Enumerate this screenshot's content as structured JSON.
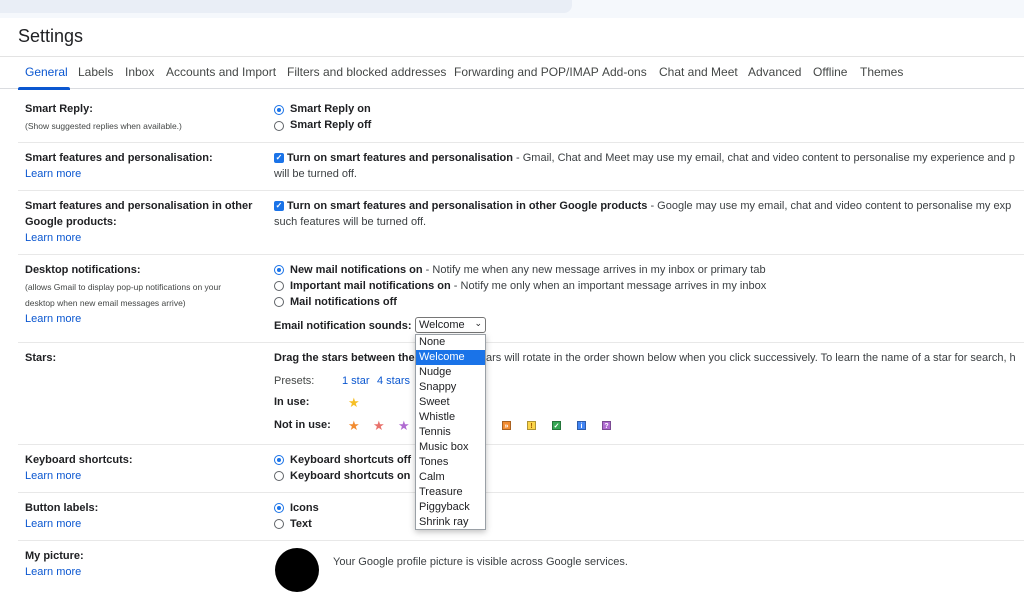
{
  "header": {
    "title": "Settings"
  },
  "tabs": [
    {
      "label": "General"
    },
    {
      "label": "Labels"
    },
    {
      "label": "Inbox"
    },
    {
      "label": "Accounts and Import"
    },
    {
      "label": "Filters and blocked addresses"
    },
    {
      "label": "Forwarding and POP/IMAP"
    },
    {
      "label": "Add-ons"
    },
    {
      "label": "Chat and Meet"
    },
    {
      "label": "Advanced"
    },
    {
      "label": "Offline"
    },
    {
      "label": "Themes"
    }
  ],
  "smart_reply": {
    "label": "Smart Reply:",
    "sub": "(Show suggested replies when available.)",
    "options": [
      "Smart Reply on",
      "Smart Reply off"
    ],
    "selected": "Smart Reply on"
  },
  "smart_features": {
    "label": "Smart features and personalisation:",
    "learn_more": "Learn more",
    "check_label": "Turn on smart features and personalisation",
    "desc1": " - Gmail, Chat and Meet may use my email, chat and video content to personalise my experience and p",
    "desc2": "will be turned off."
  },
  "smart_features_other": {
    "label1": "Smart features and personalisation in other",
    "label2": "Google products:",
    "learn_more": "Learn more",
    "check_label": "Turn on smart features and personalisation in other Google products",
    "desc1": " - Google may use my email, chat and video content to personalise my exp",
    "desc2": "such features will be turned off."
  },
  "desktop_notifications": {
    "label": "Desktop notifications:",
    "sub1": "(allows Gmail to display pop-up notifications on your",
    "sub2": "desktop when new email messages arrive)",
    "learn_more": "Learn more",
    "opt1": "New mail notifications on",
    "opt1_desc": " - Notify me when any new message arrives in my inbox or primary tab",
    "opt2": "Important mail notifications on",
    "opt2_desc": " - Notify me only when an important message arrives in my inbox",
    "opt3": "Mail notifications off",
    "sound_label": "Email notification sounds:",
    "sound_value": "Welcome",
    "sound_options": [
      "None",
      "Welcome",
      "Nudge",
      "Snappy",
      "Sweet",
      "Whistle",
      "Tennis",
      "Music box",
      "Tones",
      "Calm",
      "Treasure",
      "Piggyback",
      "Shrink ray"
    ]
  },
  "stars": {
    "label": "Stars:",
    "drag_text_a": "Drag the stars between the",
    "drag_text_b": "ars will rotate in the order shown below when you click successively. To learn the name of a star for search, h",
    "presets_label": "Presets:",
    "preset1": "1 star",
    "preset2": "4 stars",
    "in_use_label": "In use:",
    "not_in_use_label": "Not in use:",
    "colors": {
      "yellow": "#f6bf26",
      "orange": "#f28b30",
      "red": "#e8716b",
      "purple": "#b06bd1"
    }
  },
  "keyboard": {
    "label": "Keyboard shortcuts:",
    "learn_more": "Learn more",
    "opt1": "Keyboard shortcuts off",
    "opt2": "Keyboard shortcuts on"
  },
  "button_labels": {
    "label": "Button labels:",
    "learn_more": "Learn more",
    "opt1": "Icons",
    "opt2": "Text"
  },
  "my_picture": {
    "label": "My picture:",
    "learn_more": "Learn more",
    "desc": "Your Google profile picture is visible across Google services."
  }
}
